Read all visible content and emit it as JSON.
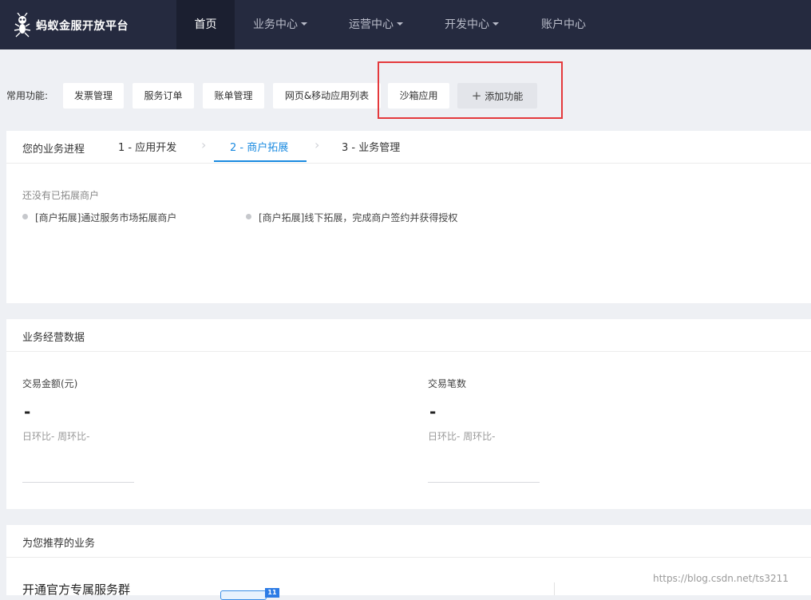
{
  "app": {
    "logo_text": "蚂蚁金服开放平台"
  },
  "nav": [
    {
      "label": "首页",
      "active": true,
      "dropdown": false
    },
    {
      "label": "业务中心",
      "active": false,
      "dropdown": true
    },
    {
      "label": "运营中心",
      "active": false,
      "dropdown": true
    },
    {
      "label": "开发中心",
      "active": false,
      "dropdown": true
    },
    {
      "label": "账户中心",
      "active": false,
      "dropdown": false
    }
  ],
  "quick": {
    "label": "常用功能:",
    "items": [
      "发票管理",
      "服务订单",
      "账单管理",
      "网页&移动应用列表",
      "沙箱应用"
    ],
    "add_label": "添加功能"
  },
  "progress": {
    "title": "您的业务进程",
    "steps": [
      "1 - 应用开发",
      "2 - 商户拓展",
      "3 - 业务管理"
    ],
    "active_step": 2,
    "empty_text": "还没有已拓展商户",
    "bullets": [
      "[商户拓展]通过服务市场拓展商户",
      "[商户拓展]线下拓展，完成商户签约并获得授权"
    ]
  },
  "business_data": {
    "title": "业务经营数据",
    "metrics": [
      {
        "label": "交易金额(元)",
        "value": "-",
        "compare": "日环比-   周环比-"
      },
      {
        "label": "交易笔数",
        "value": "-",
        "compare": "日环比-   周环比-"
      }
    ]
  },
  "recommend": {
    "title": "为您推荐的业务",
    "item_title": "开通官方专属服务群",
    "badge": "11"
  },
  "watermark": "https://blog.csdn.net/ts3211",
  "colors": {
    "nav_bg": "#252a3f",
    "accent": "#1a8ae0",
    "highlight_box": "#e4393c"
  }
}
